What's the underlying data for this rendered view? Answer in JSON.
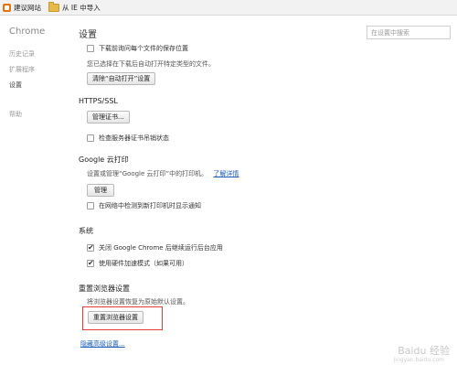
{
  "bookmarks_bar": {
    "items": [
      {
        "label": "建议网站",
        "icon": "site-favicon-icon"
      },
      {
        "label": "从 IE 中导入",
        "icon": "folder-icon"
      }
    ]
  },
  "sidebar": {
    "title": "Chrome",
    "items": [
      {
        "label": "历史记录"
      },
      {
        "label": "扩展程序"
      },
      {
        "label": "设置",
        "selected": true
      },
      {
        "label": "帮助"
      }
    ]
  },
  "main": {
    "title": "设置",
    "search": {
      "placeholder": "在设置中搜索"
    },
    "downloads": {
      "ask_location": "下载前询问每个文件的保存位置",
      "auto_open_desc": "您已选择在下载后自动打开特定类型的文件。",
      "clear_auto_open_button": "清除“自动打开”设置"
    },
    "https": {
      "heading": "HTTPS/SSL",
      "manage_certs_button": "管理证书...",
      "check_revocation": "检查服务器证书吊销状态"
    },
    "cloud_print": {
      "heading": "Google 云打印",
      "desc": "设置或管理“Google 云打印”中的打印机。",
      "learn_more": "了解详情",
      "manage_button": "管理",
      "notify_new_printers": "在网络中检测到新打印机时显示通知"
    },
    "system": {
      "heading": "系统",
      "continue_background": "关闭 Google Chrome 后继续运行后台应用",
      "hardware_accel": "使用硬件加速模式（如果可用）"
    },
    "reset": {
      "heading": "重置浏览器设置",
      "desc": "将浏览器设置恢复为原始默认设置。",
      "reset_button": "重置浏览器设置"
    },
    "hide_advanced": "隐藏高级设置..."
  },
  "watermark": {
    "text": "Baidu 经验",
    "sub": "jingyan.baidu.com"
  },
  "colors": {
    "highlight_frame": "#e23b3b",
    "link": "#1a5db6"
  }
}
